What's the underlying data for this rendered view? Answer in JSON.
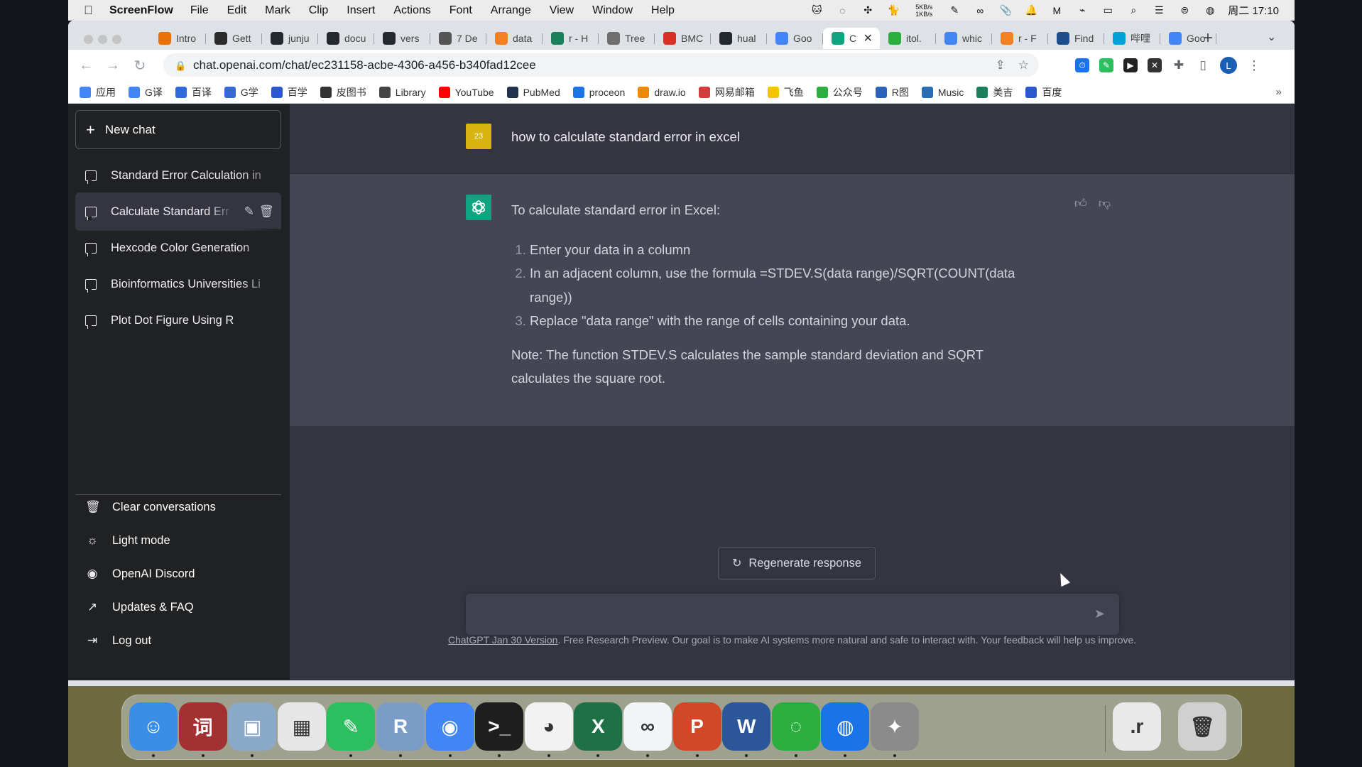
{
  "menubar": {
    "app_name": "ScreenFlow",
    "menus": [
      "File",
      "Edit",
      "Mark",
      "Clip",
      "Insert",
      "Actions",
      "Font",
      "Arrange",
      "View",
      "Window",
      "Help"
    ],
    "net_up": "5KB/s",
    "net_down": "1KB/s",
    "clock": "周二 17:10"
  },
  "browser": {
    "tabs": [
      {
        "label": "Intro",
        "color": "#e8710a"
      },
      {
        "label": "Gett",
        "color": "#2c2c2c"
      },
      {
        "label": "junju",
        "color": "#24292f"
      },
      {
        "label": "docu",
        "color": "#24292f"
      },
      {
        "label": "vers",
        "color": "#24292f"
      },
      {
        "label": "7 De",
        "color": "#555555"
      },
      {
        "label": "data",
        "color": "#f48024"
      },
      {
        "label": "r - H",
        "color": "#1a7f5a"
      },
      {
        "label": "Tree",
        "color": "#6e6e6e"
      },
      {
        "label": "BMC",
        "color": "#d93025"
      },
      {
        "label": "hual",
        "color": "#24292f"
      },
      {
        "label": "Goo",
        "color": "#4285f4"
      },
      {
        "label": "C",
        "color": "#10a37f",
        "active": true
      },
      {
        "label": "itol.",
        "color": "#2aae3e"
      },
      {
        "label": "whic",
        "color": "#4285f4"
      },
      {
        "label": "r - F",
        "color": "#f48024"
      },
      {
        "label": "Find",
        "color": "#1e4f8a"
      },
      {
        "label": "哔哩",
        "color": "#00a1d6"
      },
      {
        "label": "Goo",
        "color": "#4285f4"
      }
    ],
    "url": "chat.openai.com/chat/ec231158-acbe-4306-a456-b340fad12cee",
    "profile_initial": "L",
    "bookmarks": [
      {
        "label": "应用",
        "color": "#4285f4"
      },
      {
        "label": "G译",
        "color": "#4285f4"
      },
      {
        "label": "百译",
        "color": "#2f6bd8"
      },
      {
        "label": "G学",
        "color": "#3668d6"
      },
      {
        "label": "百学",
        "color": "#2b58d1"
      },
      {
        "label": "皮图书",
        "color": "#333333"
      },
      {
        "label": "Library",
        "color": "#444444"
      },
      {
        "label": "YouTube",
        "color": "#ff0000"
      },
      {
        "label": "PubMed",
        "color": "#20304d"
      },
      {
        "label": "proceon",
        "color": "#1a73e8"
      },
      {
        "label": "draw.io",
        "color": "#f08705"
      },
      {
        "label": "网易邮箱",
        "color": "#d23c3c"
      },
      {
        "label": "飞鱼",
        "color": "#f5c400"
      },
      {
        "label": "公众号",
        "color": "#2aae3e"
      },
      {
        "label": "R图",
        "color": "#2a63b8"
      },
      {
        "label": "Music",
        "color": "#2a6db3"
      },
      {
        "label": "美吉",
        "color": "#1a7f5a"
      },
      {
        "label": "百度",
        "color": "#2b58d1"
      }
    ]
  },
  "sidebar": {
    "new_chat": "New chat",
    "conversations": [
      {
        "label": "Standard Error Calculation in"
      },
      {
        "label": "Calculate Standard Err",
        "selected": true
      },
      {
        "label": "Hexcode Color Generation"
      },
      {
        "label": "Bioinformatics Universities Li"
      },
      {
        "label": "Plot Dot Figure Using R"
      }
    ],
    "bottom": [
      {
        "label": "Clear conversations",
        "icon": "trash-icon"
      },
      {
        "label": "Light mode",
        "icon": "sun-icon"
      },
      {
        "label": "OpenAI Discord",
        "icon": "discord-icon"
      },
      {
        "label": "Updates & FAQ",
        "icon": "external-link-icon"
      },
      {
        "label": "Log out",
        "icon": "logout-icon"
      }
    ]
  },
  "chat": {
    "user_avatar_text": "23",
    "user_message": "how to calculate standard error in excel",
    "bot_intro": "To calculate standard error in Excel:",
    "bot_steps": [
      "Enter your data in a column",
      "In an adjacent column, use the formula =STDEV.S(data range)/SQRT(COUNT(data range))",
      "Replace \"data range\" with the range of cells containing your data."
    ],
    "bot_note": "Note: The function STDEV.S calculates the sample standard deviation and SQRT calculates the square root.",
    "regenerate": "Regenerate response",
    "input_placeholder": "",
    "footer_link": "ChatGPT Jan 30 Version",
    "footer_text": ". Free Research Preview. Our goal is to make AI systems more natural and safe to interact with. Your feedback will help us improve."
  },
  "dock": {
    "apps": [
      {
        "name": "Finder",
        "color": "#3a8ee6",
        "glyph": "☺"
      },
      {
        "name": "Dict",
        "color": "#a33131",
        "glyph": "词"
      },
      {
        "name": "Preview",
        "color": "#8aa8c8",
        "glyph": "▣"
      },
      {
        "name": "Launchpad",
        "color": "#e6e6e6",
        "glyph": "▦"
      },
      {
        "name": "Evernote",
        "color": "#2dbe60",
        "glyph": "✎"
      },
      {
        "name": "R",
        "color": "#7a9cc6",
        "glyph": "R"
      },
      {
        "name": "Chrome",
        "color": "#4285f4",
        "glyph": "◉"
      },
      {
        "name": "Terminal",
        "color": "#1e1e1e",
        "glyph": ">_"
      },
      {
        "name": "QQ",
        "color": "#f2f2f2",
        "glyph": "◕"
      },
      {
        "name": "Excel",
        "color": "#1e7145",
        "glyph": "X"
      },
      {
        "name": "Baidu Netdisk",
        "color": "#f2f4f8",
        "glyph": "∞"
      },
      {
        "name": "PowerPoint",
        "color": "#d24726",
        "glyph": "P"
      },
      {
        "name": "Word",
        "color": "#2b579a",
        "glyph": "W"
      },
      {
        "name": "WeChat",
        "color": "#2aae3e",
        "glyph": "◌"
      },
      {
        "name": "Toolbox",
        "color": "#1a73e8",
        "glyph": "◍"
      },
      {
        "name": "Motion",
        "color": "#8b8b8b",
        "glyph": "✦"
      },
      {
        "name": "Document",
        "color": "#e9e9e9",
        "glyph": ".r"
      },
      {
        "name": "Trash",
        "color": "#d0d0d0",
        "glyph": "🗑"
      }
    ]
  }
}
